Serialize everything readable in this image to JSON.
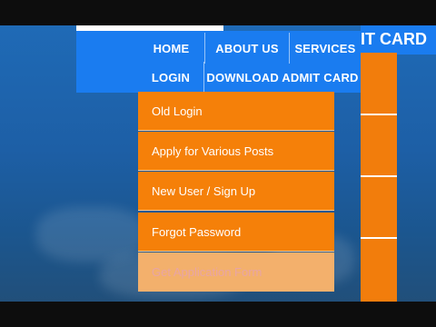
{
  "header": {
    "title_fragment": "IT CARD"
  },
  "nav": {
    "row1": [
      "HOME",
      "ABOUT US",
      "SERVICES"
    ],
    "row2": [
      "LOGIN",
      "DOWNLOAD ADMIT CARD"
    ]
  },
  "dropdown": {
    "items": [
      "Old Login",
      "Apply for Various Posts",
      "New User / Sign Up",
      "Forgot Password",
      "Get Application Form"
    ]
  },
  "colors": {
    "nav_blue": "#1a7cf0",
    "menu_orange": "#f58009",
    "background_blue": "#1f6ab6"
  }
}
